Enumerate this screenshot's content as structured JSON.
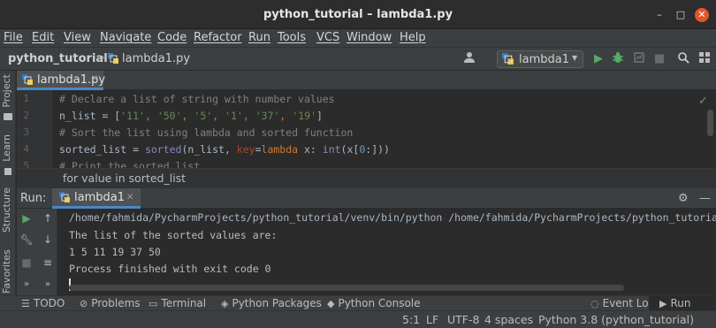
{
  "window": {
    "title": "python_tutorial – lambda1.py"
  },
  "menu": [
    "File",
    "Edit",
    "View",
    "Navigate",
    "Code",
    "Refactor",
    "Run",
    "Tools",
    "VCS",
    "Window",
    "Help"
  ],
  "breadcrumb": {
    "project": "python_tutorial",
    "file": "lambda1.py"
  },
  "run_config": {
    "label": "lambda1"
  },
  "left_tools": [
    "Project",
    "Learn",
    "Structure",
    "Favorites"
  ],
  "editor": {
    "tab": "lambda1.py",
    "lines": [
      {
        "num": "1",
        "text": "# Declare a list of string with number values"
      },
      {
        "num": "2",
        "text": "n_list = ['11', '50', '5', '1', '37', '19']"
      },
      {
        "num": "3",
        "text": "# Sort the list using lambda and sorted function"
      },
      {
        "num": "4",
        "text": "sorted_list = sorted(n_list, key=lambda x: int(x[0:]))"
      },
      {
        "num": "5",
        "text": "# Print the sorted list"
      }
    ],
    "breadcrumb": "for value in sorted_list"
  },
  "run": {
    "label": "Run:",
    "tab": "lambda1",
    "output": [
      "/home/fahmida/PycharmProjects/python_tutorial/venv/bin/python /home/fahmida/PycharmProjects/python_tutorial",
      "The list of the sorted values are:",
      "1 5 11 19 37 50",
      "Process finished with exit code 0"
    ]
  },
  "bottom_tools": {
    "todo": "TODO",
    "problems": "Problems",
    "terminal": "Terminal",
    "packages": "Python Packages",
    "console": "Python Console",
    "event_log": "Event Log",
    "run": "Run"
  },
  "status": {
    "position": "5:1",
    "line_ending": "LF",
    "encoding": "UTF-8",
    "indent": "4 spaces",
    "interpreter": "Python 3.8 (python_tutorial)"
  },
  "colors": {
    "accent": "#4a88c7",
    "run_green": "#59a869",
    "close_red": "#e2562b"
  }
}
